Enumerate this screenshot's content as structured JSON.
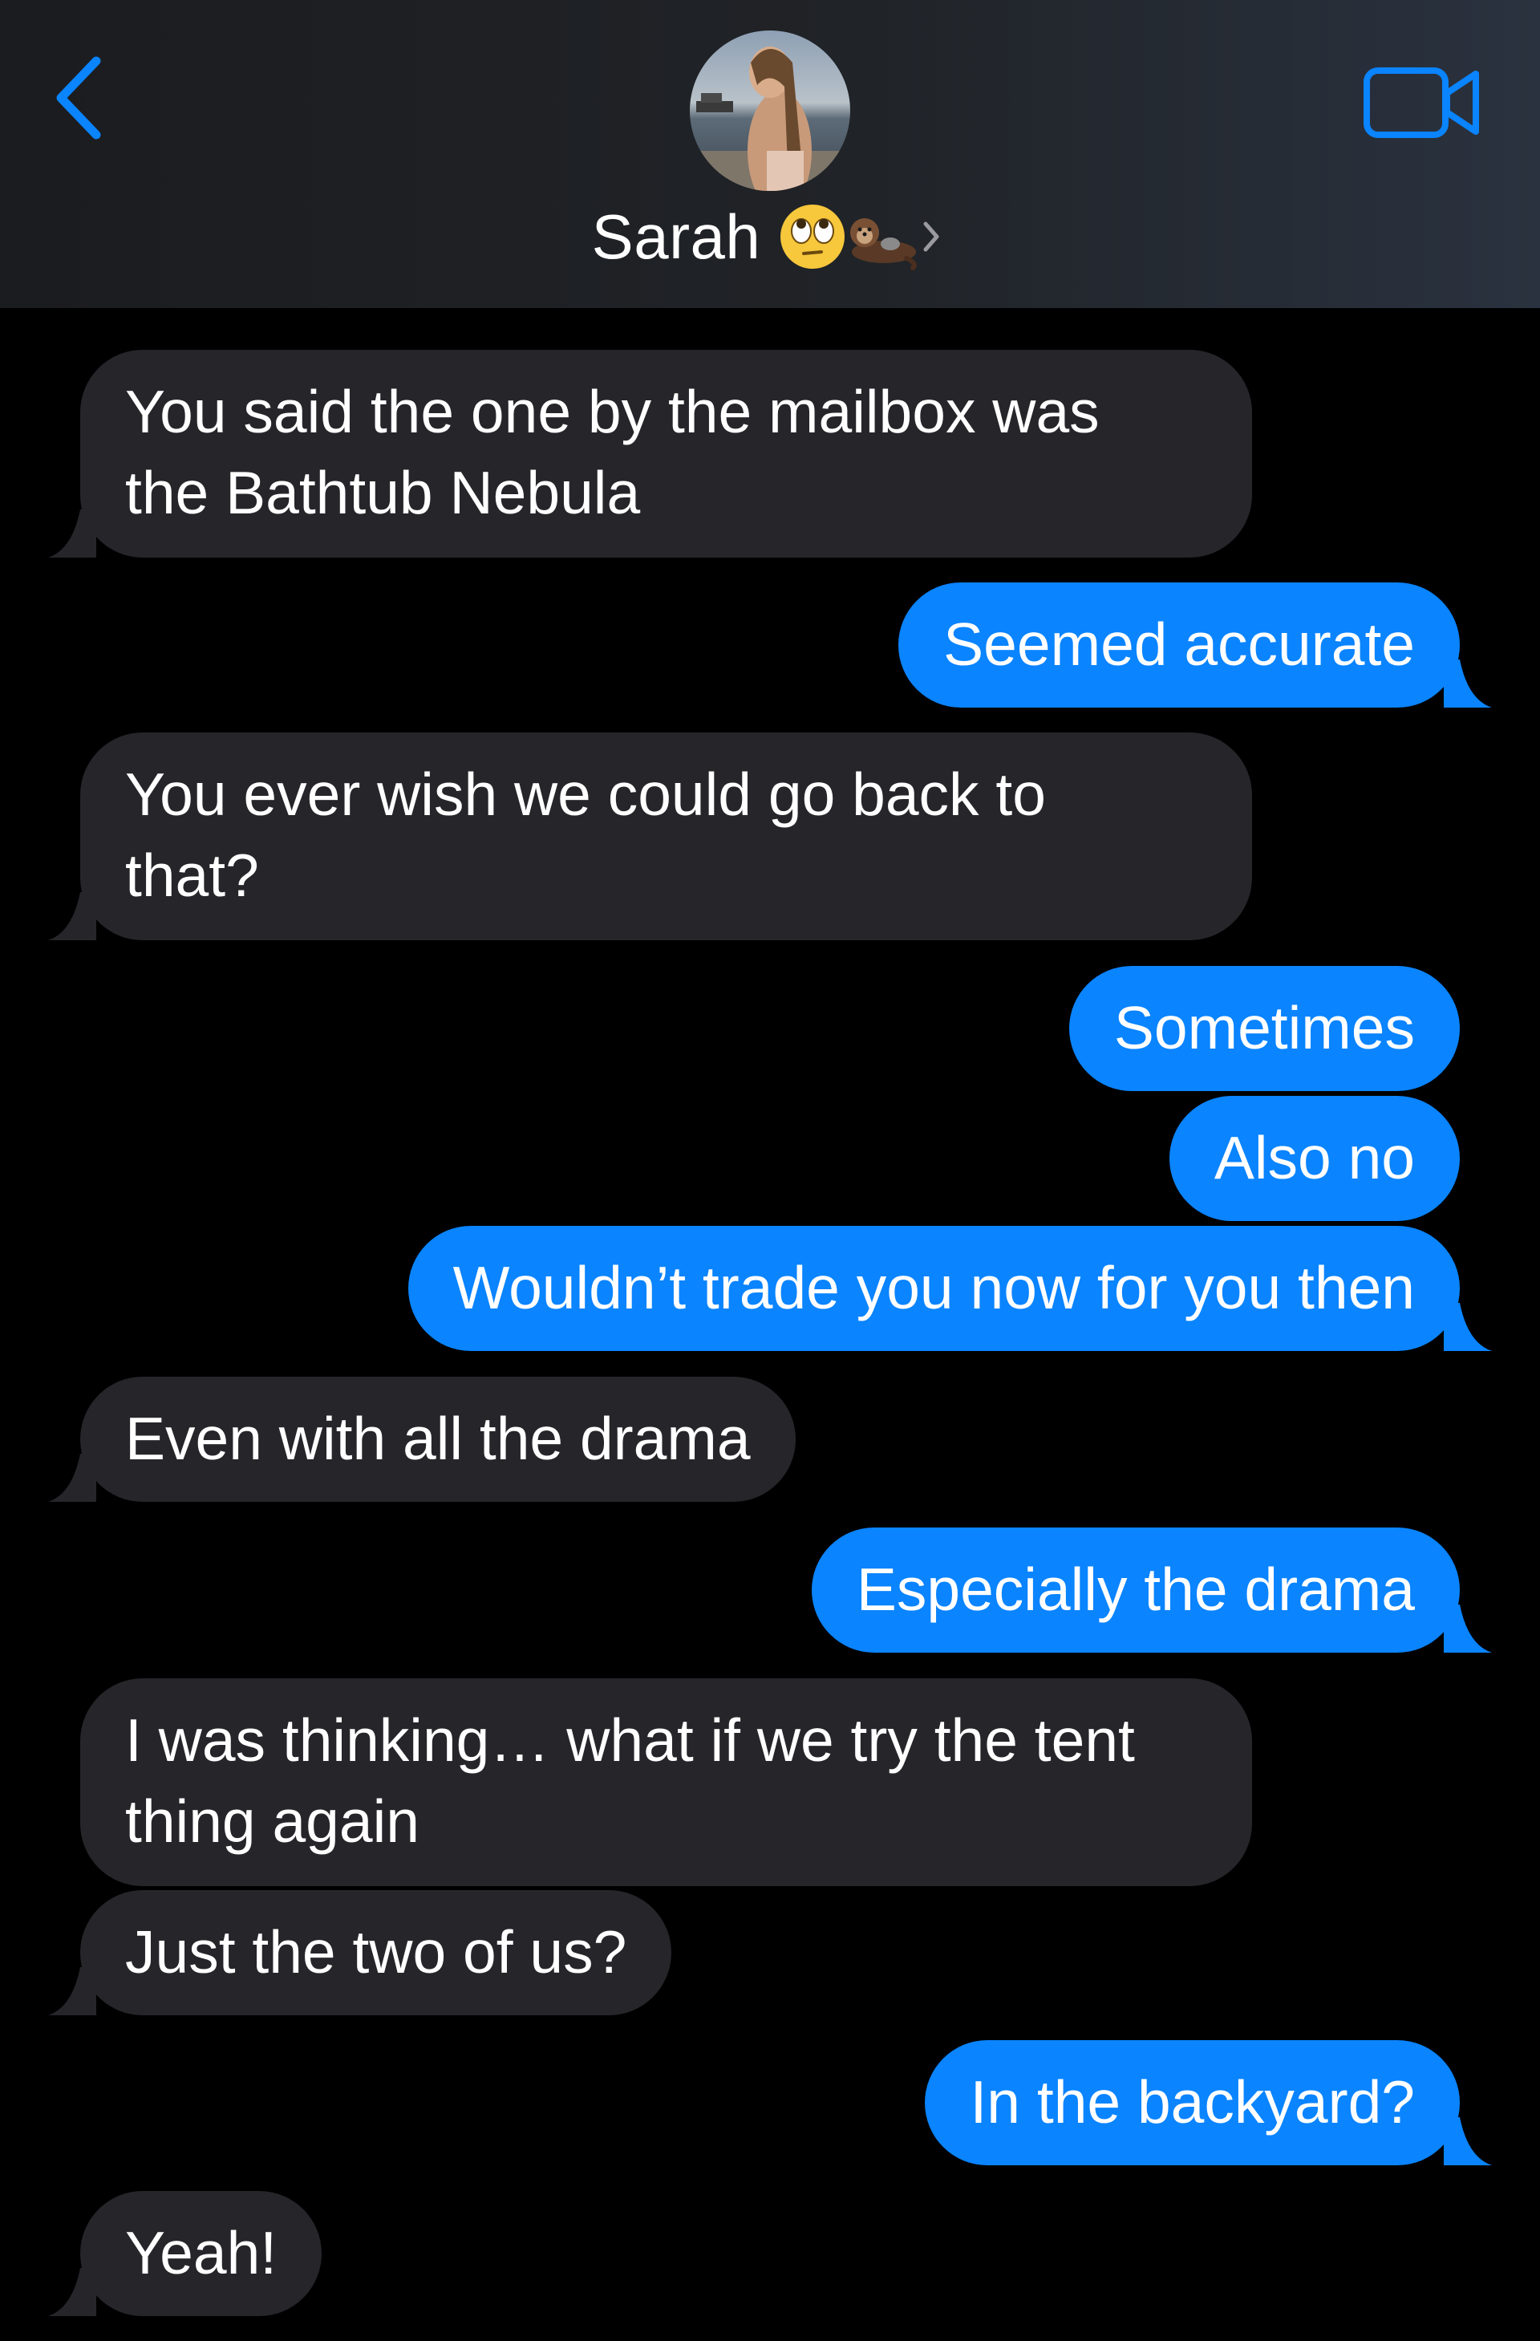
{
  "header": {
    "contact_name": "Sarah",
    "back_icon": "chevron-left-icon",
    "video_icon": "video-camera-icon",
    "emoji_1": "face-with-rolling-eyes",
    "emoji_2": "otter",
    "accent_color": "#0a84ff"
  },
  "colors": {
    "sent_bubble": "#0a84ff",
    "received_bubble": "#26252a",
    "background": "#000000"
  },
  "messages": [
    {
      "dir": "received",
      "text": "You said the one by the mailbox was\nthe Bathtub Nebula"
    },
    {
      "dir": "sent",
      "text": "Seemed accurate"
    },
    {
      "dir": "received",
      "text": "You ever wish we could go back to\nthat?"
    },
    {
      "dir": "sent",
      "text": "Sometimes"
    },
    {
      "dir": "sent",
      "text": "Also no"
    },
    {
      "dir": "sent",
      "text": "Wouldn’t trade you now for you then"
    },
    {
      "dir": "received",
      "text": "Even with all the drama"
    },
    {
      "dir": "sent",
      "text": "Especially the drama"
    },
    {
      "dir": "received",
      "text": "I was thinking… what if we try the tent\nthing again"
    },
    {
      "dir": "received",
      "text": "Just the two of us?"
    },
    {
      "dir": "sent",
      "text": "In the backyard?"
    },
    {
      "dir": "received",
      "text": "Yeah!"
    }
  ]
}
